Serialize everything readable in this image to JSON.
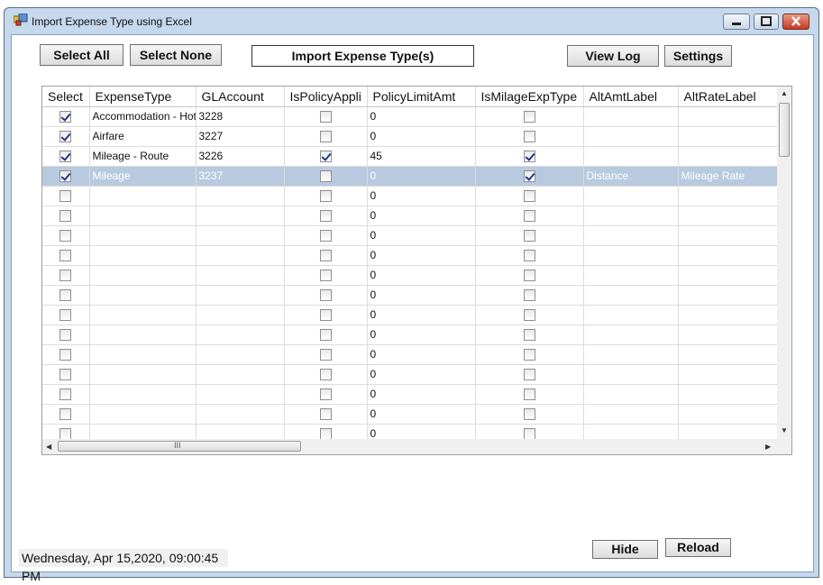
{
  "window": {
    "title": "Import Expense Type using Excel"
  },
  "toolbar": {
    "select_all": "Select All",
    "select_none": "Select None",
    "import": "Import Expense Type(s)",
    "view_log": "View Log",
    "settings": "Settings"
  },
  "grid": {
    "columns": [
      "Select",
      "ExpenseType",
      "GLAccount",
      "IsPolicyAppli",
      "PolicyLimitAmt",
      "IsMilageExpType",
      "AltAmtLabel",
      "AltRateLabel"
    ],
    "rows": [
      {
        "select": true,
        "expense_type": "Accommodation - Hotel",
        "gl_account": "3228",
        "is_policy": false,
        "policy_limit": "0",
        "is_mileage": false,
        "alt_amt": "",
        "alt_rate": ""
      },
      {
        "select": true,
        "expense_type": "Airfare",
        "gl_account": "3227",
        "is_policy": false,
        "policy_limit": "0",
        "is_mileage": false,
        "alt_amt": "",
        "alt_rate": ""
      },
      {
        "select": true,
        "expense_type": "Mileage - Route",
        "gl_account": "3226",
        "is_policy": true,
        "policy_limit": "45",
        "is_mileage": true,
        "alt_amt": "",
        "alt_rate": ""
      },
      {
        "select": true,
        "expense_type": "Mileage",
        "gl_account": "3237",
        "is_policy": false,
        "policy_limit": "0",
        "is_mileage": true,
        "alt_amt": "Distance",
        "alt_rate": "Mileage Rate",
        "selected": true
      },
      {
        "select": false,
        "expense_type": "",
        "gl_account": "",
        "is_policy": false,
        "policy_limit": "0",
        "is_mileage": false,
        "alt_amt": "",
        "alt_rate": ""
      },
      {
        "select": false,
        "expense_type": "",
        "gl_account": "",
        "is_policy": false,
        "policy_limit": "0",
        "is_mileage": false,
        "alt_amt": "",
        "alt_rate": ""
      },
      {
        "select": false,
        "expense_type": "",
        "gl_account": "",
        "is_policy": false,
        "policy_limit": "0",
        "is_mileage": false,
        "alt_amt": "",
        "alt_rate": ""
      },
      {
        "select": false,
        "expense_type": "",
        "gl_account": "",
        "is_policy": false,
        "policy_limit": "0",
        "is_mileage": false,
        "alt_amt": "",
        "alt_rate": ""
      },
      {
        "select": false,
        "expense_type": "",
        "gl_account": "",
        "is_policy": false,
        "policy_limit": "0",
        "is_mileage": false,
        "alt_amt": "",
        "alt_rate": ""
      },
      {
        "select": false,
        "expense_type": "",
        "gl_account": "",
        "is_policy": false,
        "policy_limit": "0",
        "is_mileage": false,
        "alt_amt": "",
        "alt_rate": ""
      },
      {
        "select": false,
        "expense_type": "",
        "gl_account": "",
        "is_policy": false,
        "policy_limit": "0",
        "is_mileage": false,
        "alt_amt": "",
        "alt_rate": ""
      },
      {
        "select": false,
        "expense_type": "",
        "gl_account": "",
        "is_policy": false,
        "policy_limit": "0",
        "is_mileage": false,
        "alt_amt": "",
        "alt_rate": ""
      },
      {
        "select": false,
        "expense_type": "",
        "gl_account": "",
        "is_policy": false,
        "policy_limit": "0",
        "is_mileage": false,
        "alt_amt": "",
        "alt_rate": ""
      },
      {
        "select": false,
        "expense_type": "",
        "gl_account": "",
        "is_policy": false,
        "policy_limit": "0",
        "is_mileage": false,
        "alt_amt": "",
        "alt_rate": ""
      },
      {
        "select": false,
        "expense_type": "",
        "gl_account": "",
        "is_policy": false,
        "policy_limit": "0",
        "is_mileage": false,
        "alt_amt": "",
        "alt_rate": ""
      },
      {
        "select": false,
        "expense_type": "",
        "gl_account": "",
        "is_policy": false,
        "policy_limit": "0",
        "is_mileage": false,
        "alt_amt": "",
        "alt_rate": ""
      },
      {
        "select": false,
        "expense_type": "",
        "gl_account": "",
        "is_policy": false,
        "policy_limit": "0",
        "is_mileage": false,
        "alt_amt": "",
        "alt_rate": ""
      }
    ],
    "hscroll_glyph": "III"
  },
  "status": {
    "datetime": "Wednesday, Apr 15,2020, 09:00:45 PM"
  },
  "footer": {
    "hide": "Hide",
    "reload": "Reload"
  },
  "colors": {
    "selected_row": "#b7cadf",
    "window_frame": "#c6d8ec",
    "checkmark": "#24348b"
  },
  "icons": {
    "app": "window-app-icon",
    "minimize": "minimize-icon",
    "maximize": "maximize-icon",
    "close": "close-icon"
  }
}
